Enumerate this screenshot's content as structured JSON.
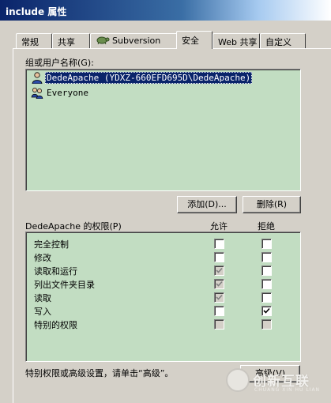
{
  "window": {
    "title": "include 属性"
  },
  "tabs": [
    {
      "label": "常规"
    },
    {
      "label": "共享"
    },
    {
      "label": "Subversion",
      "icon": "svn-turtle-icon"
    },
    {
      "label": "安全",
      "active": true
    },
    {
      "label": "Web 共享"
    },
    {
      "label": "自定义"
    }
  ],
  "security": {
    "group_label": "组或用户名称(G):",
    "users": [
      {
        "name": "DedeApache (YDXZ-660EFD695D\\DedeApache)",
        "icon": "user-icon",
        "selected": true
      },
      {
        "name": "Everyone",
        "icon": "group-icon",
        "selected": false
      }
    ],
    "add_button": "添加(D)...",
    "remove_button": "删除(R)",
    "perm_label": "DedeApache 的权限(P)",
    "allow_header": "允许",
    "deny_header": "拒绝",
    "permissions": [
      {
        "name": "完全控制",
        "allow": false,
        "allow_disabled": false,
        "deny": false,
        "deny_disabled": false
      },
      {
        "name": "修改",
        "allow": false,
        "allow_disabled": false,
        "deny": false,
        "deny_disabled": false
      },
      {
        "name": "读取和运行",
        "allow": true,
        "allow_disabled": true,
        "deny": false,
        "deny_disabled": false
      },
      {
        "name": "列出文件夹目录",
        "allow": true,
        "allow_disabled": true,
        "deny": false,
        "deny_disabled": false
      },
      {
        "name": "读取",
        "allow": true,
        "allow_disabled": true,
        "deny": false,
        "deny_disabled": false
      },
      {
        "name": "写入",
        "allow": false,
        "allow_disabled": false,
        "deny": true,
        "deny_disabled": false
      },
      {
        "name": "特别的权限",
        "allow": false,
        "allow_disabled": true,
        "deny": false,
        "deny_disabled": true
      }
    ],
    "advanced_hint": "特别权限或高级设置，请单击“高级”。",
    "advanced_button": "高级(V)"
  },
  "watermark": {
    "name": "创新互联",
    "sub": "CHUANG XIN HU LIAN"
  }
}
